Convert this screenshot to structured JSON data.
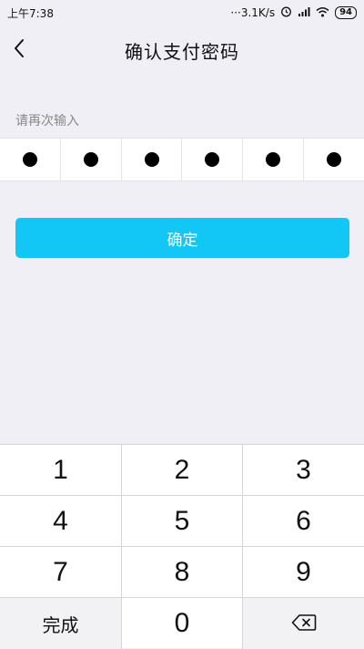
{
  "status_bar": {
    "time": "上午7:38",
    "net_speed": "···3.1K/s",
    "battery": "94",
    "icons": [
      "alarm-icon",
      "signal-icon",
      "wifi-icon",
      "battery-icon"
    ]
  },
  "header": {
    "title": "确认支付密码",
    "back_icon": "chevron-left-icon"
  },
  "form": {
    "hint": "请再次输入",
    "pin_filled": 6,
    "pin_length": 6,
    "confirm_label": "确定",
    "accent_color": "#12c6f6"
  },
  "keypad": {
    "keys": [
      "1",
      "2",
      "3",
      "4",
      "5",
      "6",
      "7",
      "8",
      "9",
      "完成",
      "0",
      "backspace"
    ],
    "done_label": "完成",
    "zero_label": "0",
    "backspace_icon": "backspace-icon"
  }
}
